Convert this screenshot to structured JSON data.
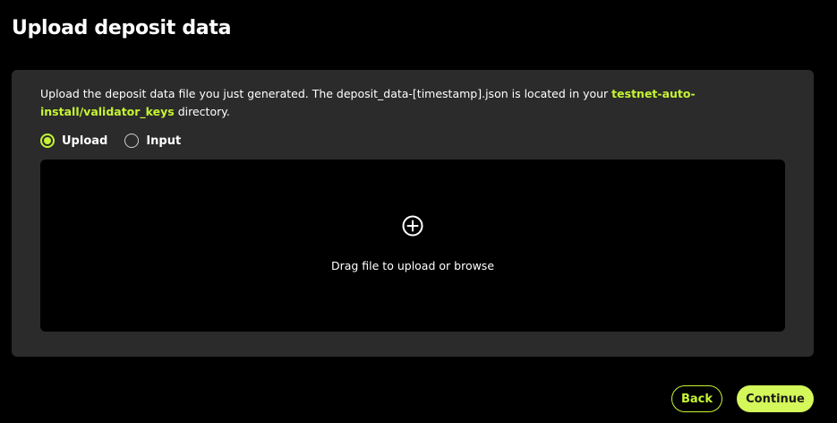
{
  "header": {
    "title": "Upload deposit data"
  },
  "card": {
    "instructions_prefix": "Upload the deposit data file you just generated. The deposit_data-[timestamp].json is located in your ",
    "instructions_path": "testnet-auto-install/validator_keys",
    "instructions_suffix": " directory.",
    "radio_options": [
      {
        "label": "Upload",
        "selected": true
      },
      {
        "label": "Input",
        "selected": false
      }
    ],
    "dropzone": {
      "icon": "plus-circle-icon",
      "text": "Drag file to upload or browse"
    }
  },
  "footer": {
    "back_label": "Back",
    "continue_label": "Continue"
  },
  "colors": {
    "accent": "#c6f432",
    "card_background": "#2b2b2b",
    "page_background": "#000000"
  }
}
